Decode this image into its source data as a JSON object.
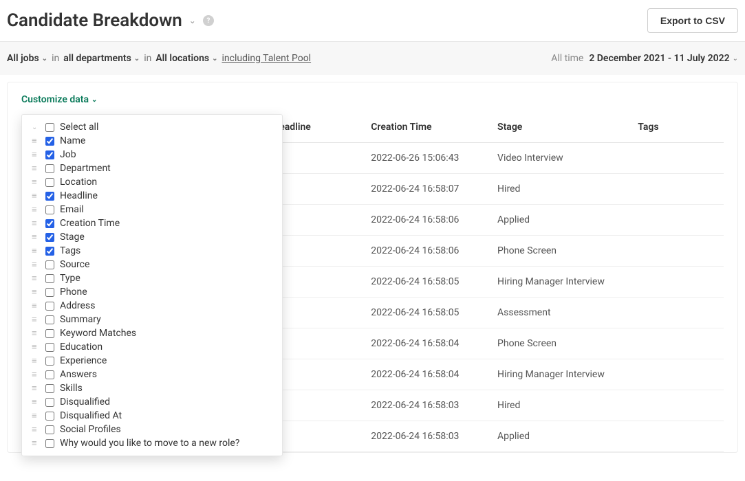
{
  "header": {
    "title": "Candidate Breakdown",
    "help_icon": "?",
    "export_label": "Export to CSV"
  },
  "filters": {
    "jobs": "All jobs",
    "in1": "in",
    "departments": "all departments",
    "in2": "in",
    "locations": "All locations",
    "talent_pool": "including Talent Pool",
    "all_time": "All time",
    "date_range": "2 December 2021 - 11 July 2022"
  },
  "customize": {
    "button_label": "Customize data",
    "options": [
      {
        "label": "Select all",
        "checked": false,
        "collapse": true
      },
      {
        "label": "Name",
        "checked": true
      },
      {
        "label": "Job",
        "checked": true
      },
      {
        "label": "Department",
        "checked": false
      },
      {
        "label": "Location",
        "checked": false
      },
      {
        "label": "Headline",
        "checked": true
      },
      {
        "label": "Email",
        "checked": false
      },
      {
        "label": "Creation Time",
        "checked": true
      },
      {
        "label": "Stage",
        "checked": true
      },
      {
        "label": "Tags",
        "checked": true
      },
      {
        "label": "Source",
        "checked": false
      },
      {
        "label": "Type",
        "checked": false
      },
      {
        "label": "Phone",
        "checked": false
      },
      {
        "label": "Address",
        "checked": false
      },
      {
        "label": "Summary",
        "checked": false
      },
      {
        "label": "Keyword Matches",
        "checked": false
      },
      {
        "label": "Education",
        "checked": false
      },
      {
        "label": "Experience",
        "checked": false
      },
      {
        "label": "Answers",
        "checked": false
      },
      {
        "label": "Skills",
        "checked": false
      },
      {
        "label": "Disqualified",
        "checked": false
      },
      {
        "label": "Disqualified At",
        "checked": false
      },
      {
        "label": "Social Profiles",
        "checked": false
      },
      {
        "label": "Why would you like to move to a new role?",
        "checked": false
      }
    ]
  },
  "table": {
    "headers": {
      "headline": "Headline",
      "creation": "Creation Time",
      "stage": "Stage",
      "tags": "Tags"
    },
    "rows": [
      {
        "creation": "2022-06-26 15:06:43",
        "stage": "Video Interview"
      },
      {
        "creation": "2022-06-24 16:58:07",
        "stage": "Hired"
      },
      {
        "creation": "2022-06-24 16:58:06",
        "stage": "Applied"
      },
      {
        "creation": "2022-06-24 16:58:06",
        "stage": "Phone Screen"
      },
      {
        "creation": "2022-06-24 16:58:05",
        "stage": "Hiring Manager Interview"
      },
      {
        "creation": "2022-06-24 16:58:05",
        "stage": "Assessment"
      },
      {
        "creation": "2022-06-24 16:58:04",
        "stage": "Phone Screen"
      },
      {
        "creation": "2022-06-24 16:58:04",
        "stage": "Hiring Manager Interview"
      },
      {
        "creation": "2022-06-24 16:58:03",
        "stage": "Hired"
      },
      {
        "creation": "2022-06-24 16:58:03",
        "stage": "Applied"
      }
    ]
  }
}
